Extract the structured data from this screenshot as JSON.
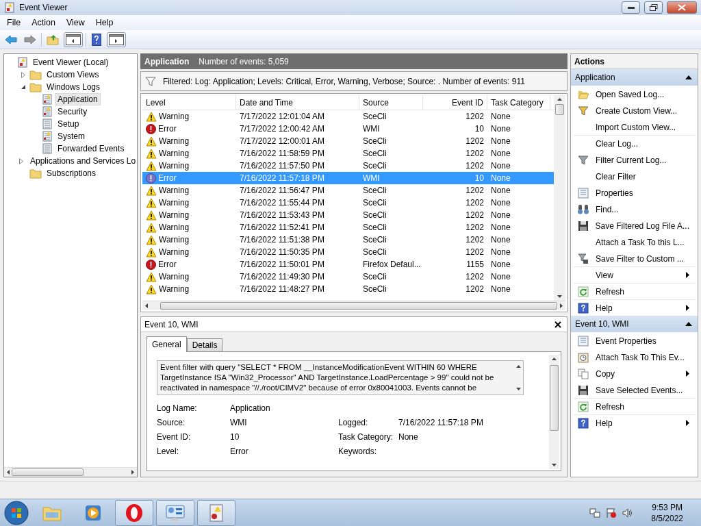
{
  "window": {
    "title": "Event Viewer"
  },
  "menu": [
    "File",
    "Action",
    "View",
    "Help"
  ],
  "tree": [
    {
      "label": "Event Viewer (Local)",
      "kind": "viewer",
      "selected": false,
      "children": [
        {
          "label": "Custom Views",
          "kind": "folder",
          "expanded": false,
          "selected": false
        },
        {
          "label": "Windows Logs",
          "kind": "folder",
          "expanded": true,
          "selected": false,
          "children": [
            {
              "label": "Application",
              "kind": "log",
              "selected": true
            },
            {
              "label": "Security",
              "kind": "log",
              "selected": false
            },
            {
              "label": "Setup",
              "kind": "log-plain",
              "selected": false
            },
            {
              "label": "System",
              "kind": "log",
              "selected": false
            },
            {
              "label": "Forwarded Events",
              "kind": "log-plain",
              "selected": false
            }
          ]
        },
        {
          "label": "Applications and Services Lo",
          "kind": "folder",
          "expanded": false,
          "selected": false
        },
        {
          "label": "Subscriptions",
          "kind": "folder",
          "selected": false
        }
      ]
    }
  ],
  "log_header": {
    "title": "Application",
    "count": "Number of events: 5,059"
  },
  "filter": "Filtered: Log: Application; Levels: Critical, Error, Warning, Verbose; Source: . Number of events: 911",
  "table": {
    "columns": [
      "Level",
      "Date and Time",
      "Source",
      "Event ID",
      "Task Category"
    ],
    "rows": [
      {
        "kind": "warning",
        "level": "Warning",
        "date": "7/17/2022 12:01:04 AM",
        "source": "SceCli",
        "id": "1202",
        "category": "None",
        "selected": false
      },
      {
        "kind": "error",
        "level": "Error",
        "date": "7/17/2022 12:00:42 AM",
        "source": "WMI",
        "id": "10",
        "category": "None",
        "selected": false
      },
      {
        "kind": "warning",
        "level": "Warning",
        "date": "7/17/2022 12:00:01 AM",
        "source": "SceCli",
        "id": "1202",
        "category": "None",
        "selected": false
      },
      {
        "kind": "warning",
        "level": "Warning",
        "date": "7/16/2022 11:58:59 PM",
        "source": "SceCli",
        "id": "1202",
        "category": "None",
        "selected": false
      },
      {
        "kind": "warning",
        "level": "Warning",
        "date": "7/16/2022 11:57:50 PM",
        "source": "SceCli",
        "id": "1202",
        "category": "None",
        "selected": false
      },
      {
        "kind": "error",
        "level": "Error",
        "date": "7/16/2022 11:57:18 PM",
        "source": "WMI",
        "id": "10",
        "category": "None",
        "selected": true
      },
      {
        "kind": "warning",
        "level": "Warning",
        "date": "7/16/2022 11:56:47 PM",
        "source": "SceCli",
        "id": "1202",
        "category": "None",
        "selected": false
      },
      {
        "kind": "warning",
        "level": "Warning",
        "date": "7/16/2022 11:55:44 PM",
        "source": "SceCli",
        "id": "1202",
        "category": "None",
        "selected": false
      },
      {
        "kind": "warning",
        "level": "Warning",
        "date": "7/16/2022 11:53:43 PM",
        "source": "SceCli",
        "id": "1202",
        "category": "None",
        "selected": false
      },
      {
        "kind": "warning",
        "level": "Warning",
        "date": "7/16/2022 11:52:41 PM",
        "source": "SceCli",
        "id": "1202",
        "category": "None",
        "selected": false
      },
      {
        "kind": "warning",
        "level": "Warning",
        "date": "7/16/2022 11:51:38 PM",
        "source": "SceCli",
        "id": "1202",
        "category": "None",
        "selected": false
      },
      {
        "kind": "warning",
        "level": "Warning",
        "date": "7/16/2022 11:50:35 PM",
        "source": "SceCli",
        "id": "1202",
        "category": "None",
        "selected": false
      },
      {
        "kind": "error",
        "level": "Error",
        "date": "7/16/2022 11:50:01 PM",
        "source": "Firefox Defaul...",
        "id": "1155",
        "category": "None",
        "selected": false
      },
      {
        "kind": "warning",
        "level": "Warning",
        "date": "7/16/2022 11:49:30 PM",
        "source": "SceCli",
        "id": "1202",
        "category": "None",
        "selected": false
      },
      {
        "kind": "warning",
        "level": "Warning",
        "date": "7/16/2022 11:48:27 PM",
        "source": "SceCli",
        "id": "1202",
        "category": "None",
        "selected": false
      }
    ]
  },
  "detail": {
    "title": "Event 10, WMI",
    "tabs": [
      {
        "label": "General",
        "selected": true
      },
      {
        "label": "Details",
        "selected": false
      }
    ],
    "description": "Event filter with query \"SELECT * FROM __InstanceModificationEvent WITHIN 60 WHERE TargetInstance ISA \"Win32_Processor\" AND TargetInstance.LoadPercentage > 99\" could not be reactivated in namespace \"//./root/CIMV2\" because of error 0x80041003. Events cannot be",
    "fields": [
      {
        "left": {
          "label": "Log Name:",
          "value": "Application"
        }
      },
      {
        "left": {
          "label": "Source:",
          "value": "WMI"
        },
        "right": {
          "label": "Logged:",
          "value": "7/16/2022 11:57:18 PM"
        }
      },
      {
        "left": {
          "label": "Event ID:",
          "value": "10"
        },
        "right": {
          "label": "Task Category:",
          "value": "None"
        }
      },
      {
        "left": {
          "label": "Level:",
          "value": "Error"
        },
        "right": {
          "label": "Keywords:"
        }
      }
    ]
  },
  "actions": {
    "title": "Actions",
    "sections": [
      {
        "title": "Application",
        "expanded": true,
        "items": [
          {
            "label": "Open Saved Log...",
            "kind": "open",
            "submenu": false,
            "separator_before": false
          },
          {
            "label": "Create Custom View...",
            "kind": "funnel-gold",
            "submenu": false,
            "separator_before": false
          },
          {
            "label": "Import Custom View...",
            "kind": "none",
            "submenu": false,
            "separator_before": false
          },
          {
            "label": "Clear Log...",
            "kind": "none",
            "submenu": false,
            "separator_before": true
          },
          {
            "label": "Filter Current Log...",
            "kind": "funnel",
            "submenu": false,
            "separator_before": false
          },
          {
            "label": "Clear Filter",
            "kind": "none",
            "submenu": false,
            "separator_before": false
          },
          {
            "label": "Properties",
            "kind": "properties",
            "submenu": false,
            "separator_before": false
          },
          {
            "label": "Find...",
            "kind": "find",
            "submenu": false,
            "separator_before": false
          },
          {
            "label": "Save Filtered Log File A...",
            "kind": "save",
            "submenu": false,
            "separator_before": false
          },
          {
            "label": "Attach a Task To this L...",
            "kind": "none",
            "submenu": false,
            "separator_before": false
          },
          {
            "label": "Save Filter to Custom ...",
            "kind": "funnel-save",
            "submenu": false,
            "separator_before": false
          },
          {
            "label": "View",
            "kind": "none",
            "submenu": true,
            "separator_before": true
          },
          {
            "label": "Refresh",
            "kind": "refresh",
            "submenu": false,
            "separator_before": true
          },
          {
            "label": "Help",
            "kind": "help",
            "submenu": true,
            "separator_before": true
          }
        ]
      },
      {
        "title": "Event 10, WMI",
        "expanded": true,
        "items": [
          {
            "label": "Event Properties",
            "kind": "properties",
            "submenu": false,
            "separator_before": false
          },
          {
            "label": "Attach Task To This Ev...",
            "kind": "task",
            "submenu": false,
            "separator_before": false
          },
          {
            "label": "Copy",
            "kind": "copy",
            "submenu": true,
            "separator_before": false
          },
          {
            "label": "Save Selected Events...",
            "kind": "save",
            "submenu": false,
            "separator_before": false
          },
          {
            "label": "Refresh",
            "kind": "refresh",
            "submenu": false,
            "separator_before": true
          },
          {
            "label": "Help",
            "kind": "help",
            "submenu": true,
            "separator_before": true
          }
        ]
      }
    ]
  },
  "taskbar": {
    "time": "9:53 PM",
    "date": "8/5/2022"
  }
}
